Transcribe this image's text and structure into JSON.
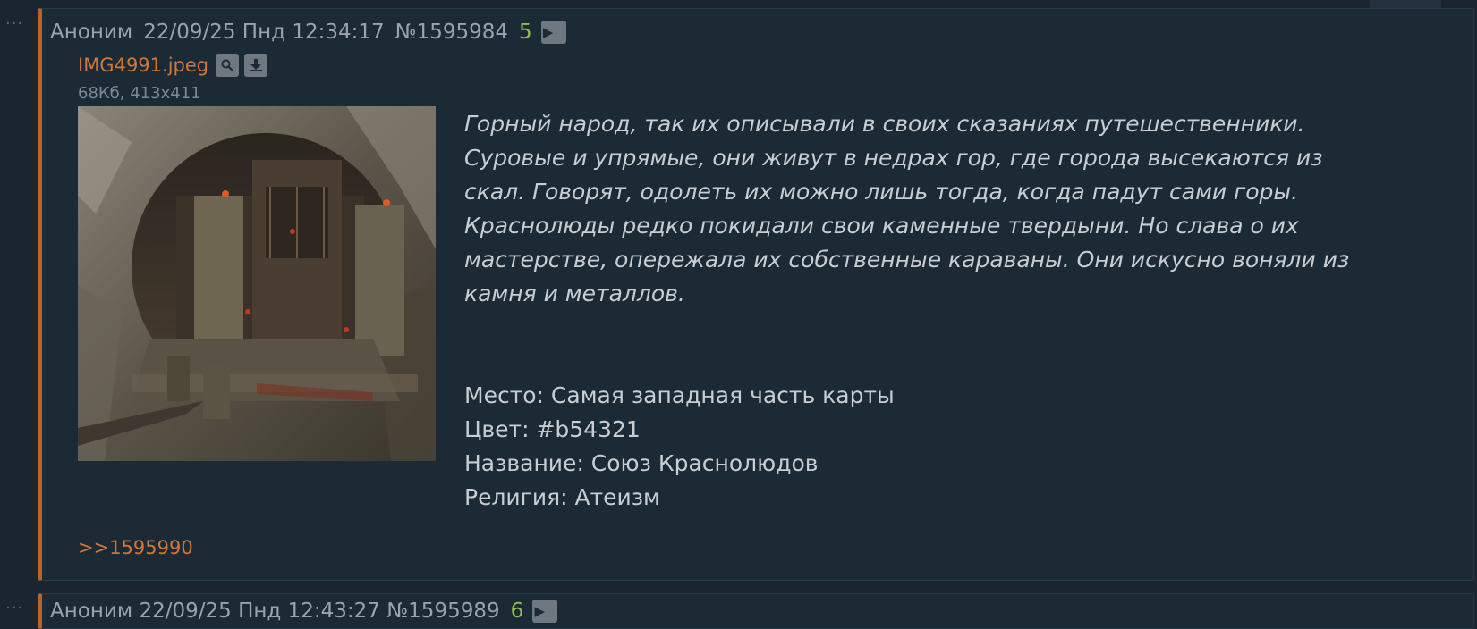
{
  "post": {
    "author": "Аноним",
    "datetime": "22/09/25 Пнд 12:34:17",
    "number": "№1595984",
    "replies": "5",
    "file": {
      "name": "IMG4991.jpeg",
      "meta": "68Кб, 413x411"
    },
    "lore": [
      "Горный народ, так их описывали в своих сказаниях путешественники.",
      "Суровые и упрямые, они живут в недрах гор, где города высекаются из",
      "скал. Говорят, одолеть их можно лишь тогда, когда падут сами горы.",
      "Краснолюды редко покидали свои каменные твердыни. Но слава о их",
      "мастерстве, опережала их собственные караваны. Они искусно воняли из",
      "камня и металлов."
    ],
    "details": [
      "Место: Самая западная часть карты",
      "Цвет: #b54321",
      "Название: Союз Краснолюдов",
      "Религия: Атеизм"
    ],
    "reply_link": ">>1595990"
  },
  "next_post": {
    "header": "Аноним 22/09/25 Пнд 12:43:27 №1595989",
    "replies": "6"
  },
  "colors": {
    "accent": "#b86428",
    "link": "#d0763a",
    "replies": "#8fbf4a",
    "background": "#1a2530",
    "post_bg": "#1c2a36"
  }
}
